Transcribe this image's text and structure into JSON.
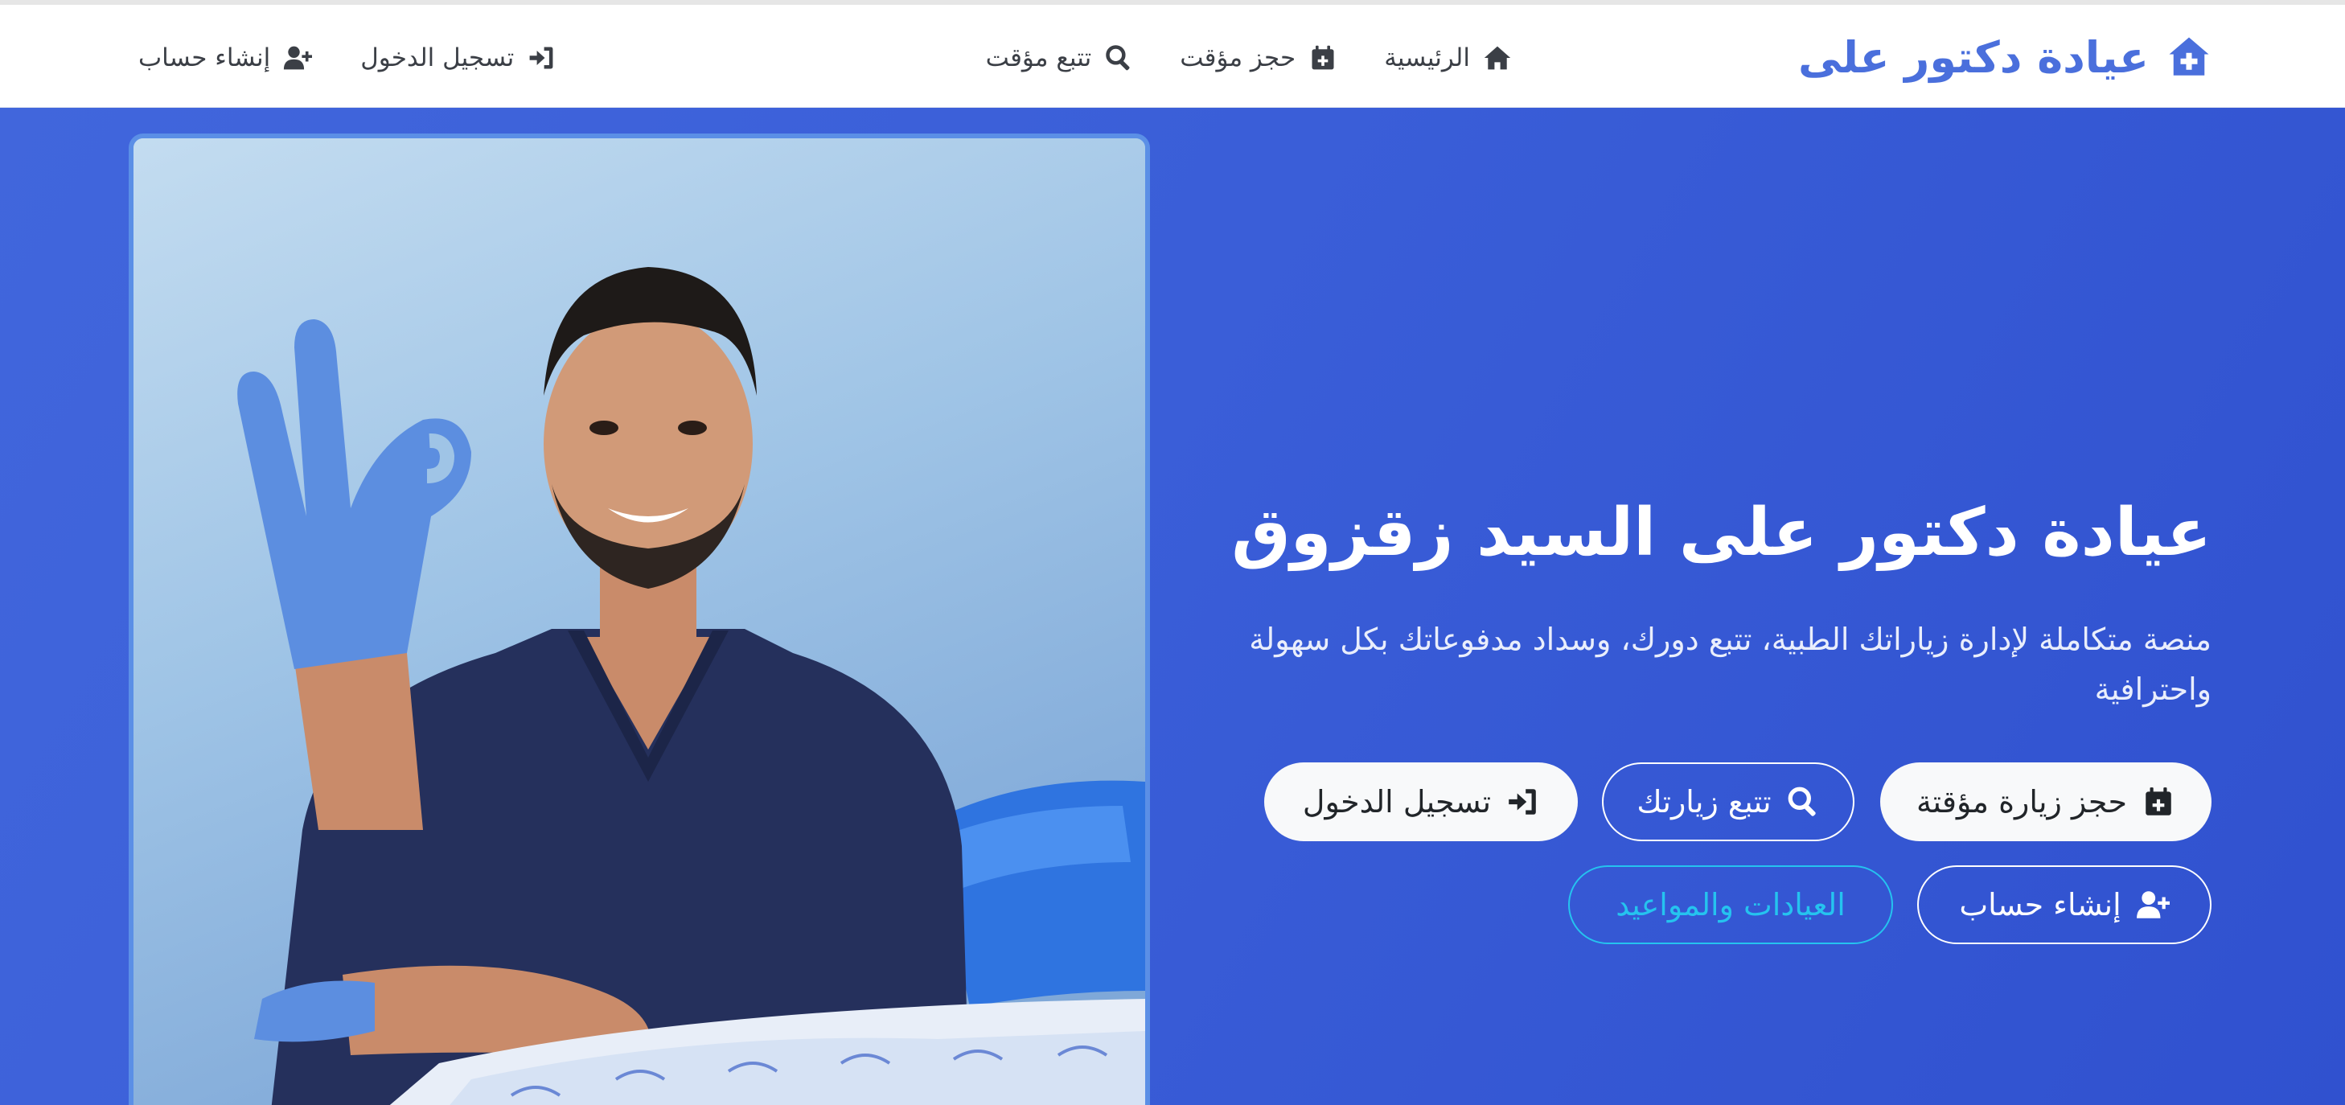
{
  "navbar": {
    "brand": "عيادة دكتور على",
    "links": {
      "home": "الرئيسية",
      "book": "حجز مؤقت",
      "track": "تتبع مؤقت",
      "login": "تسجيل الدخول",
      "signup": "إنشاء حساب"
    },
    "icons": {
      "brand": "clinic-house-icon",
      "home": "home-icon",
      "book": "calendar-plus-icon",
      "track": "search-icon",
      "login": "sign-in-icon",
      "signup": "user-plus-icon"
    }
  },
  "hero": {
    "title": "عيادة دكتور على السيد زقزوق",
    "description": "منصة متكاملة لإدارة زياراتك الطبية، تتبع دورك، وسداد مدفوعاتك بكل سهولة واحترافية",
    "buttons": {
      "book": "حجز زيارة مؤقتة",
      "track": "تتبع زيارتك",
      "login": "تسجيل الدخول",
      "signup": "إنشاء حساب",
      "clinics": "العيادات والمواعيد"
    }
  },
  "colors": {
    "brand": "#4a6fdc",
    "hero_bg": "#3a5ed8",
    "accent_cyan": "#25c3ef",
    "nav_text": "#3b3f46"
  }
}
